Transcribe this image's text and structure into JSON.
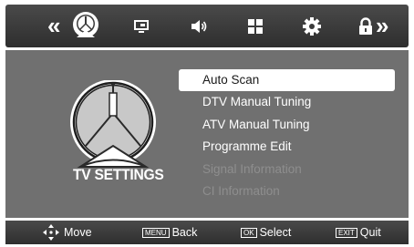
{
  "top_tabs": [
    {
      "name": "channel-tab",
      "icon": "satellite-dish-icon",
      "active": true
    },
    {
      "name": "picture-tab",
      "icon": "picture-icon"
    },
    {
      "name": "sound-tab",
      "icon": "speaker-icon"
    },
    {
      "name": "time-tab",
      "icon": "grid-icon"
    },
    {
      "name": "setup-tab",
      "icon": "gear-icon"
    },
    {
      "name": "lock-tab",
      "icon": "lock-icon"
    }
  ],
  "nav": {
    "prev": "«",
    "next": "»"
  },
  "panel": {
    "title": "TV SETTINGS",
    "illustration_icon": "satellite-dish-icon"
  },
  "menu": {
    "items": [
      {
        "label": "Auto Scan",
        "state": "selected"
      },
      {
        "label": "DTV Manual Tuning",
        "state": "enabled"
      },
      {
        "label": "ATV Manual Tuning",
        "state": "enabled"
      },
      {
        "label": "Programme Edit",
        "state": "enabled"
      },
      {
        "label": "Signal Information",
        "state": "disabled"
      },
      {
        "label": "CI Information",
        "state": "disabled"
      }
    ]
  },
  "hints": {
    "move_label": "Move",
    "back_key": "MENU",
    "back_label": "Back",
    "select_key": "OK",
    "select_label": "Select",
    "quit_key": "EXIT",
    "quit_label": "Quit"
  },
  "colors": {
    "bar": "#3a3a3a",
    "panel": "#707070",
    "selected_bg": "#ffffff",
    "disabled_text": "#8e8e8e"
  }
}
